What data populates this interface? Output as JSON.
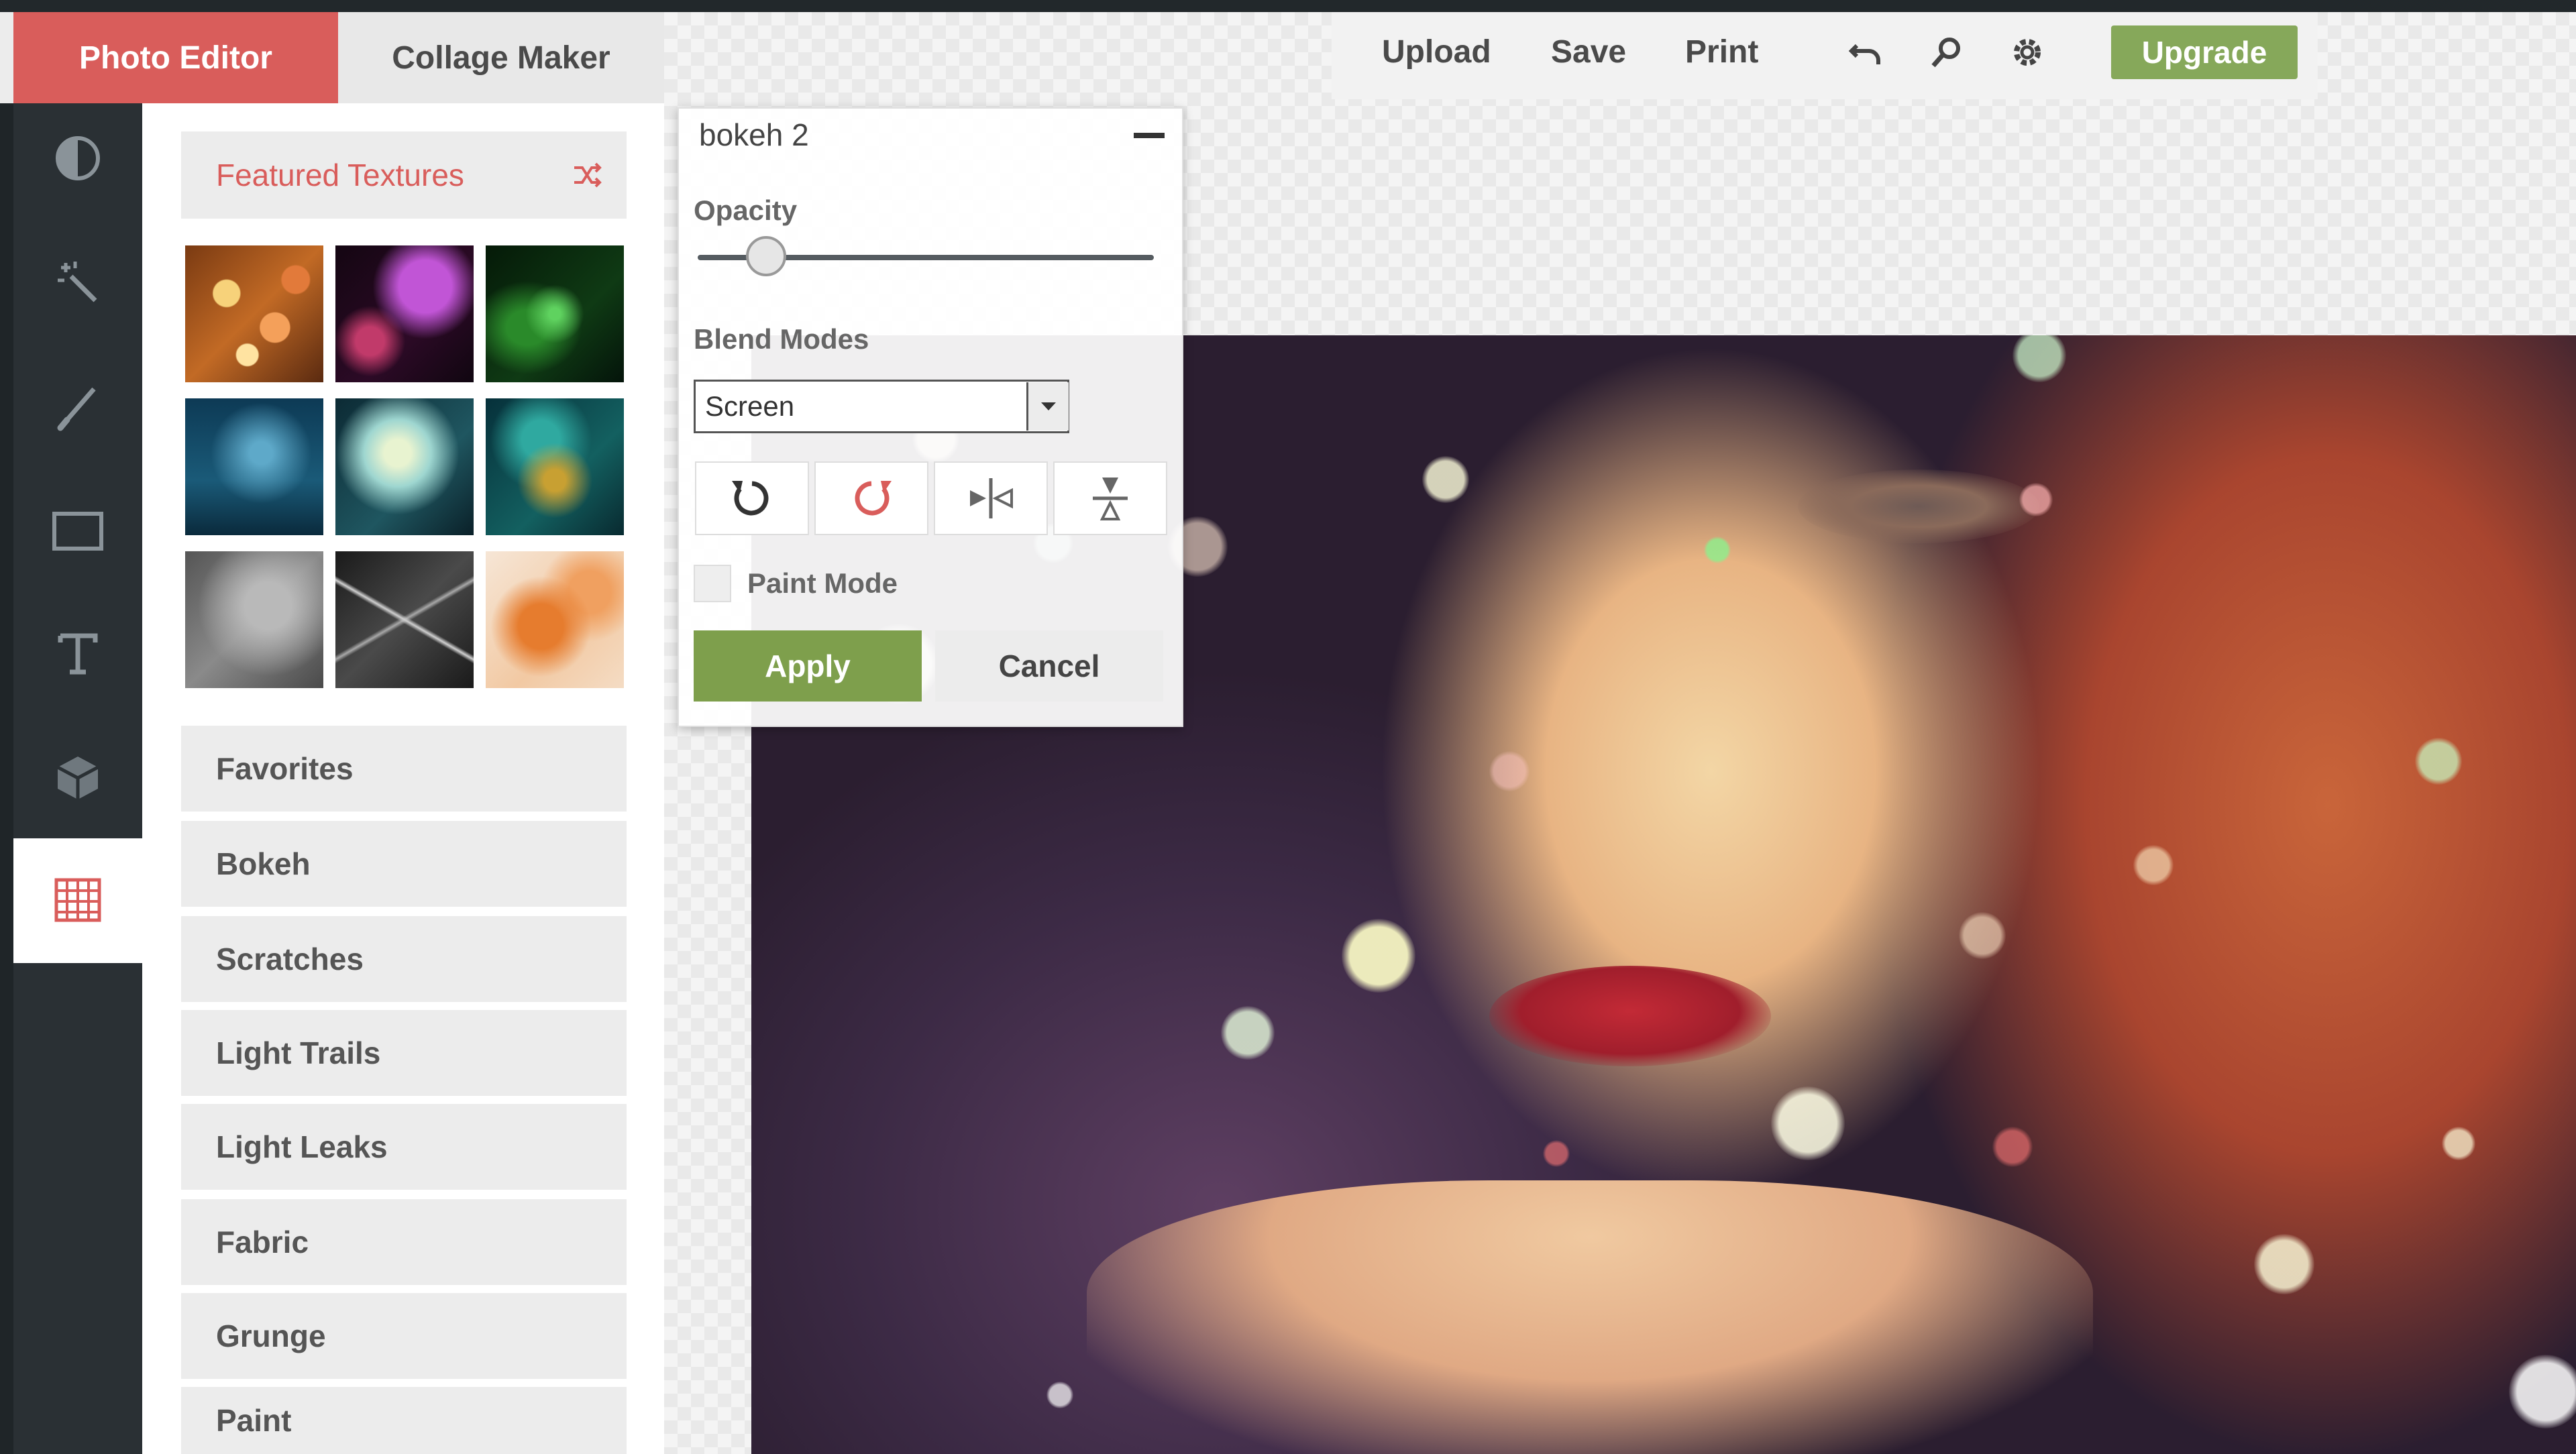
{
  "tabs": {
    "photo_editor": "Photo Editor",
    "collage_maker": "Collage Maker"
  },
  "toolbar": {
    "upload": "Upload",
    "save": "Save",
    "print": "Print",
    "upgrade": "Upgrade",
    "icons": [
      "undo-icon",
      "search-icon",
      "gear-icon"
    ]
  },
  "rail": {
    "icons": [
      "contrast-icon",
      "magic-wand-icon",
      "brush-icon",
      "frame-icon",
      "text-icon",
      "cube-icon",
      "texture-icon"
    ],
    "active": "texture-icon"
  },
  "panel": {
    "featured_title": "Featured Textures",
    "categories": [
      "Favorites",
      "Bokeh",
      "Scratches",
      "Light Trails",
      "Light Leaks",
      "Fabric",
      "Grunge",
      "Paint"
    ]
  },
  "dialog": {
    "title": "bokeh 2",
    "opacity_label": "Opacity",
    "opacity_value": 0.15,
    "blend_label": "Blend Modes",
    "blend_value": "Screen",
    "paint_mode_label": "Paint Mode",
    "apply": "Apply",
    "cancel": "Cancel"
  },
  "colors": {
    "accent_red": "#d95d5b",
    "accent_green": "#7e9f4c",
    "rail_dark": "#2a3034"
  }
}
